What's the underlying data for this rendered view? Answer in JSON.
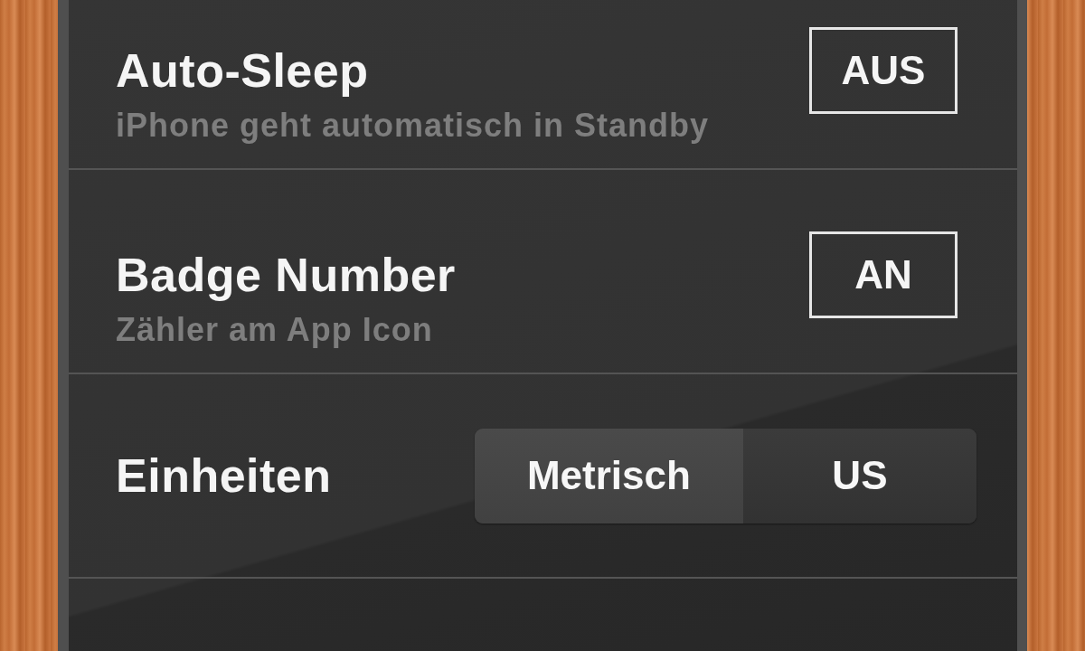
{
  "settings": [
    {
      "kind": "toggle",
      "title": "Auto-Sleep",
      "subtitle": "iPhone geht automatisch in Standby",
      "value": "AUS"
    },
    {
      "kind": "toggle",
      "title": "Badge Number",
      "subtitle": "Zähler am App Icon",
      "value": "AN"
    },
    {
      "kind": "segmented",
      "title": "Einheiten",
      "options": [
        {
          "label": "Metrisch",
          "selected": true
        },
        {
          "label": "US",
          "selected": false
        }
      ]
    }
  ]
}
